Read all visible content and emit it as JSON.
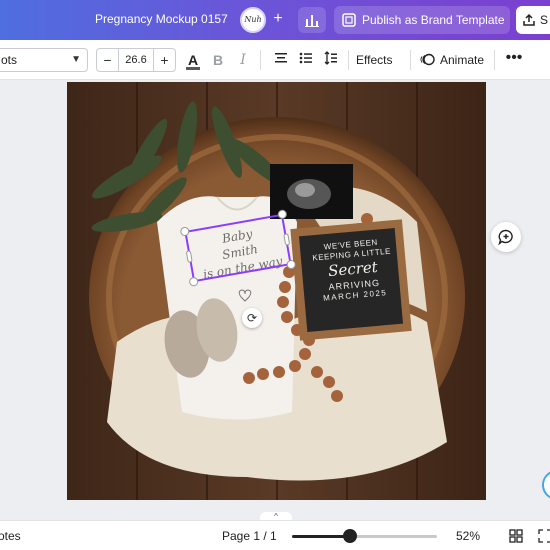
{
  "header": {
    "doc_title": "Pregnancy Mockup 0157",
    "avatar_text": "Nuh",
    "publish_label": "Publish as Brand Template",
    "share_label": "S"
  },
  "toolbar": {
    "font_name": "ots",
    "font_size": "26.6",
    "minus": "−",
    "plus": "+",
    "color_label": "A",
    "bold_label": "B",
    "italic_label": "I",
    "effects_label": "Effects",
    "animate_label": "Animate",
    "more_label": "•••"
  },
  "canvas": {
    "onesie_text": [
      "Baby",
      "Smith",
      "is on the way"
    ],
    "letterboard": {
      "line1": "WE'VE BEEN",
      "line2": "KEEPING A LITTLE",
      "line3": "Secret",
      "line4": "ARRIVING",
      "line5": "MARCH 2025"
    }
  },
  "bottombar": {
    "notes_label": "otes",
    "page_indicator": "Page 1 / 1",
    "zoom_value": "52%",
    "zoom_fraction": 0.4
  },
  "colors": {
    "accent": "#8b3dff",
    "header_gradient_start": "#4f6ee0",
    "header_gradient_end": "#7b3fcf"
  }
}
